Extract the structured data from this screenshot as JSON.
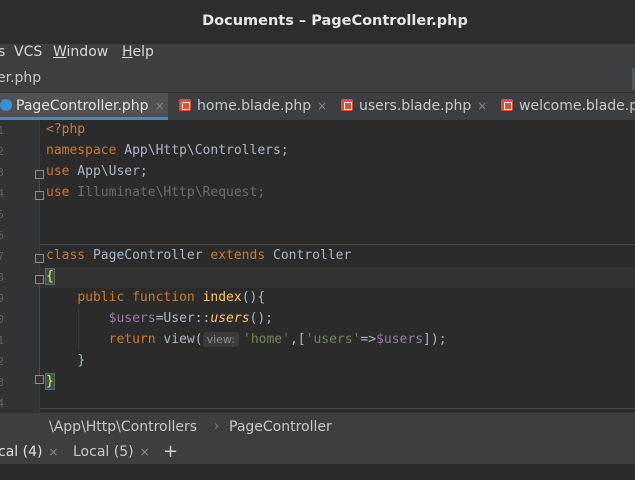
{
  "window": {
    "title": "Documents – PageController.php"
  },
  "menu": [
    {
      "pre": "",
      "ul": "",
      "post": "s"
    },
    {
      "pre": "",
      "ul": "",
      "post": "VCS"
    },
    {
      "pre": "",
      "ul": "W",
      "post": "indow"
    },
    {
      "pre": "",
      "ul": "H",
      "post": "elp"
    }
  ],
  "navbar": {
    "crumb": "er.php"
  },
  "tabs": [
    {
      "label": "PageController.php",
      "icon": "php-class-icon",
      "active": true
    },
    {
      "label": "home.blade.php",
      "icon": "blade-file-icon",
      "active": false
    },
    {
      "label": "users.blade.php",
      "icon": "blade-file-icon",
      "active": false
    },
    {
      "label": "welcome.blade.p",
      "icon": "blade-file-icon",
      "active": false
    }
  ],
  "close_glyph": "×",
  "gutter": {
    "line_numbers": [
      "1",
      "2",
      "3",
      "4",
      "5",
      "6",
      "7",
      "8",
      "9",
      "0",
      "1",
      "2",
      "3",
      "4"
    ]
  },
  "code": {
    "l1": {
      "t": "<?php"
    },
    "l2": {
      "kw": "namespace",
      "t": " App\\Http\\Controllers;"
    },
    "l3": {
      "kw": "use",
      "t": " App\\User;"
    },
    "l4": {
      "kw": "use",
      "t": " Illuminate\\Http\\Request;"
    },
    "l6": {
      "kw1": "class",
      "t1": " PageController ",
      "kw2": "extends",
      "t2": " Controller"
    },
    "l7": {
      "brace": "{"
    },
    "l8": {
      "indent": "    ",
      "kw1": "public",
      "sp": " ",
      "kw2": "function",
      "sp2": " ",
      "fn": "index",
      "t": "(){"
    },
    "l9": {
      "indent": "        ",
      "var": "$users",
      "t1": "=User::",
      "stat": "users",
      "t2": "();"
    },
    "l10": {
      "indent": "        ",
      "kw": "return",
      "t1": " view(",
      "hint": "view:",
      "str1": "'home'",
      "t2": ",[",
      "str2": "'users'",
      "t3": "=>",
      "var": "$users",
      "t4": "]);"
    },
    "l11": {
      "indent": "    ",
      "t": "}"
    },
    "l12": {
      "brace": "}"
    }
  },
  "statusbar": {
    "crumbs": [
      "\\App\\Http\\Controllers",
      "PageController"
    ],
    "chevron": "›"
  },
  "terminal": {
    "tabs": [
      {
        "label": "cal (4)",
        "active": true
      },
      {
        "label": "Local (5)",
        "active": false
      }
    ],
    "add": "+"
  },
  "colors": {
    "keyword": "#cc7832",
    "function": "#ffc66d",
    "variable": "#9876aa",
    "string": "#6a8759",
    "accent": "#4a88c7"
  }
}
